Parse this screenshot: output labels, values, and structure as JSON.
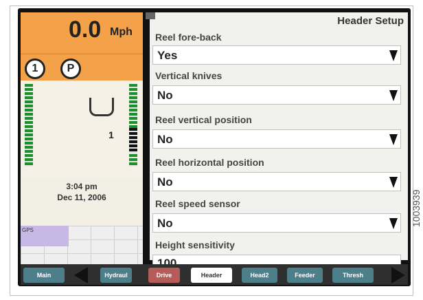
{
  "status": {
    "speed_value": "0.0",
    "speed_unit": "Mph",
    "gear_number": "1",
    "park_letter": "P",
    "count_value": "1",
    "time": "3:04 pm",
    "date": "Dec 11, 2006",
    "gps_label": "GPS"
  },
  "header": {
    "title": "Header Setup"
  },
  "settings": [
    {
      "label": "Reel fore-back",
      "value": "Yes",
      "has_dropdown": true
    },
    {
      "label": "Vertical knives",
      "value": "No",
      "has_dropdown": true
    },
    {
      "label": "Reel vertical position",
      "value": "No",
      "has_dropdown": true
    },
    {
      "label": "Reel horizontal position",
      "value": "No",
      "has_dropdown": true
    },
    {
      "label": "Reel speed sensor",
      "value": "No",
      "has_dropdown": true
    },
    {
      "label": "Height sensitivity",
      "value": "100",
      "has_dropdown": false
    }
  ],
  "tabs": [
    {
      "label": "Main"
    },
    {
      "label": "Hydraul"
    },
    {
      "label": "Drive"
    },
    {
      "label": "Header",
      "active": true
    },
    {
      "label": "Head2"
    },
    {
      "label": "Feeder"
    },
    {
      "label": "Thresh"
    }
  ],
  "figure_number": "1003939",
  "colors": {
    "status_orange": "#f3a24a",
    "tab_teal": "#4d7f8b",
    "tab_drive": "#b55b58",
    "bar_green": "#1d8f2a"
  },
  "icons": [
    "left-arrow-icon",
    "right-arrow-icon",
    "reel-icon",
    "dropdown-arrow-icon",
    "header-icon"
  ]
}
